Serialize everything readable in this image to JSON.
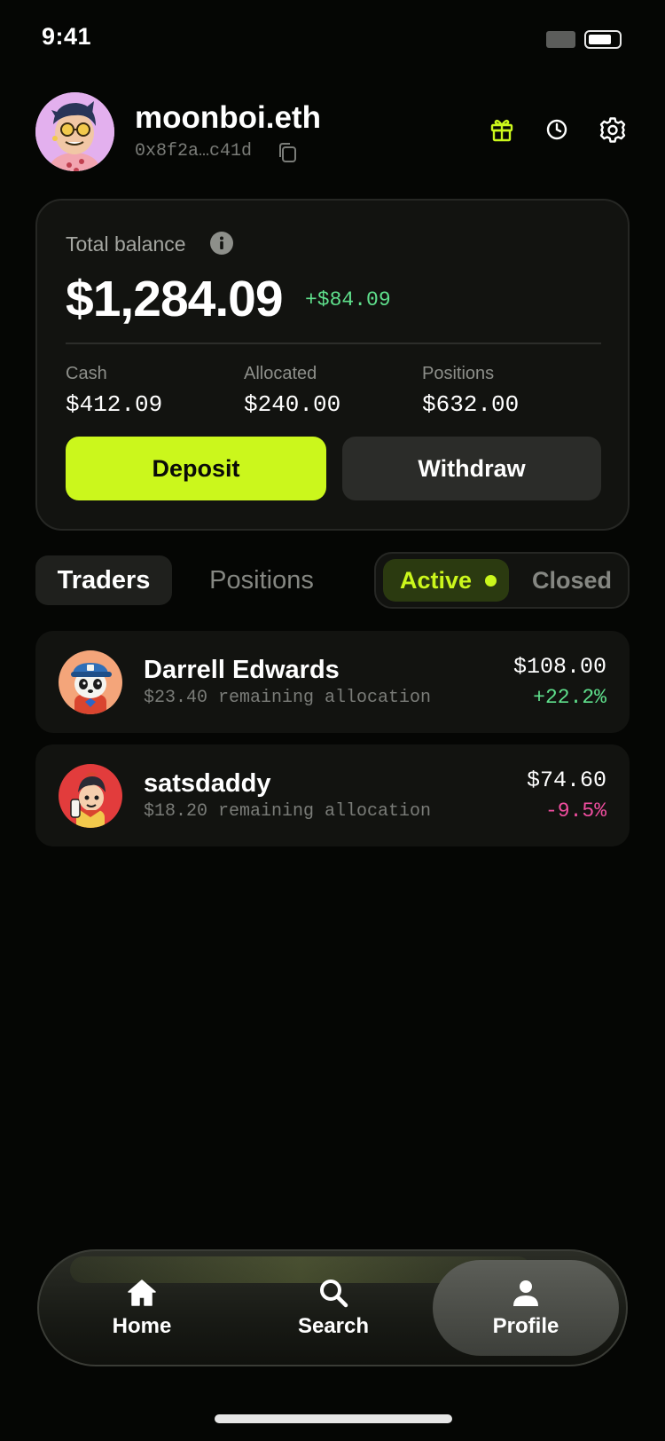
{
  "status_bar": {
    "time": "9:41"
  },
  "profile": {
    "username": "moonboi.eth",
    "address": "0x8f2a…c41d",
    "icons": [
      "gift-icon",
      "history-icon",
      "gear-icon"
    ]
  },
  "balance": {
    "label": "Total balance",
    "amount": "$1,284.09",
    "change": "+$84.09",
    "stats": [
      {
        "label": "Cash",
        "value": "$412.09"
      },
      {
        "label": "Allocated",
        "value": "$240.00"
      },
      {
        "label": "Positions",
        "value": "$632.00"
      }
    ],
    "deposit_label": "Deposit",
    "withdraw_label": "Withdraw"
  },
  "tabs": {
    "traders": "Traders",
    "positions": "Positions"
  },
  "filter": {
    "active": "Active",
    "closed": "Closed"
  },
  "traders": [
    {
      "name": "Darrell Edwards",
      "sub": "$23.40 remaining allocation",
      "value": "$108.00",
      "change": "+22.2%"
    },
    {
      "name": "satsdaddy",
      "sub": "$18.20 remaining allocation",
      "value": "$74.60",
      "change": "-9.5%"
    }
  ],
  "nav": {
    "home": "Home",
    "search": "Search",
    "profile": "Profile"
  },
  "colors": {
    "accent": "#cbf71c",
    "positive": "#5fe08c",
    "negative": "#f14ea0",
    "background": "#050604"
  }
}
